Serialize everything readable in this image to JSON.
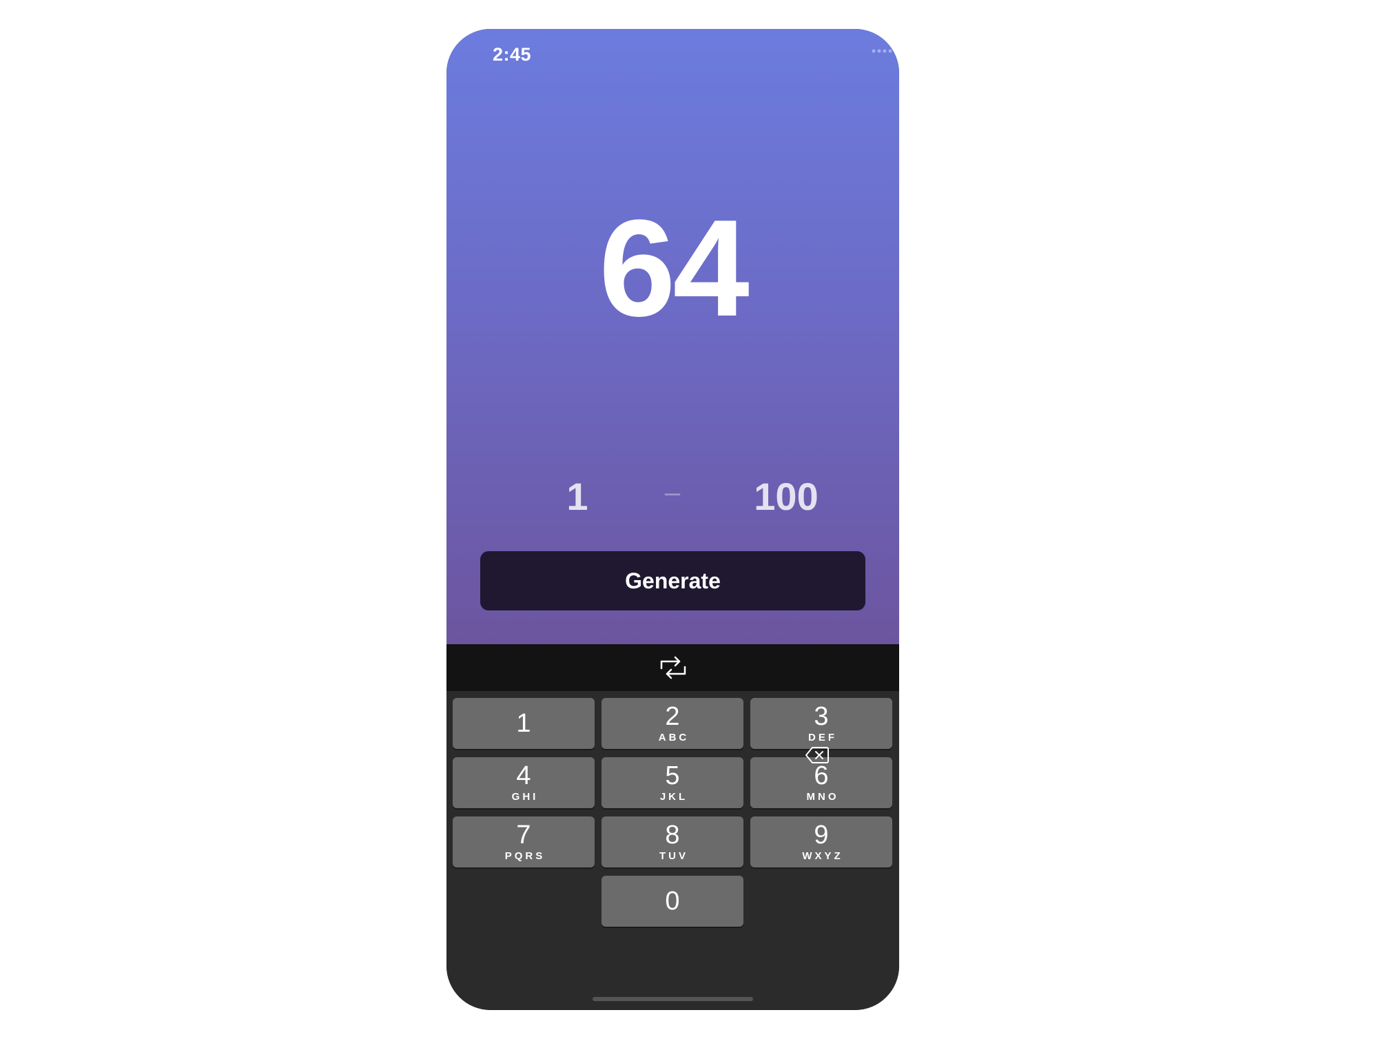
{
  "status_bar": {
    "time": "2:45"
  },
  "result": {
    "value": "64"
  },
  "range": {
    "min": "1",
    "separator": "–",
    "max": "100"
  },
  "generate_button": {
    "label": "Generate"
  },
  "toolbar": {
    "icon": "swap-arrows-icon"
  },
  "keypad": {
    "keys": [
      {
        "num": "1",
        "letters": ""
      },
      {
        "num": "2",
        "letters": "ABC"
      },
      {
        "num": "3",
        "letters": "DEF"
      },
      {
        "num": "4",
        "letters": "GHI"
      },
      {
        "num": "5",
        "letters": "JKL"
      },
      {
        "num": "6",
        "letters": "MNO"
      },
      {
        "num": "7",
        "letters": "PQRS"
      },
      {
        "num": "8",
        "letters": "TUV"
      },
      {
        "num": "9",
        "letters": "WXYZ"
      },
      {
        "num": "0",
        "letters": ""
      }
    ],
    "delete_icon": "backspace-icon"
  },
  "colors": {
    "gradient_top": "#6c7cde",
    "gradient_bottom": "#6c559f",
    "button_bg": "#1f1830",
    "key_bg": "#6b6b6b",
    "keypad_bg": "#2b2b2b",
    "toolbar_bg": "#131313"
  }
}
